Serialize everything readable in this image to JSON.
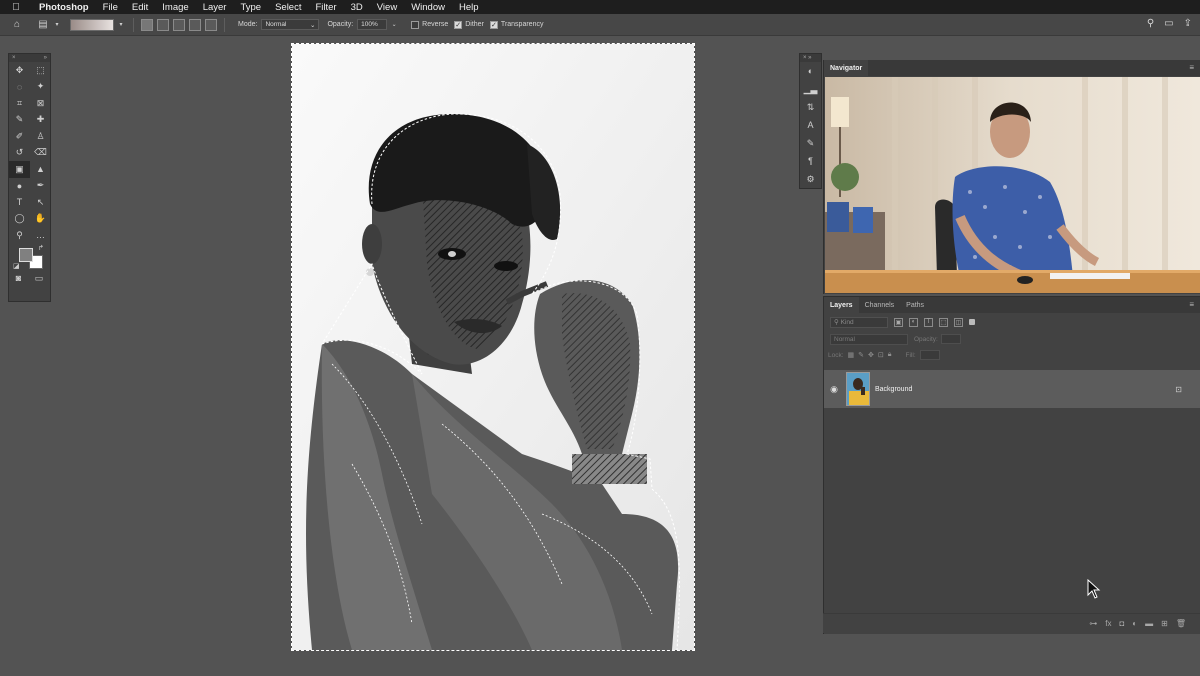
{
  "menubar": {
    "apple": "",
    "app_name": "Photoshop",
    "items": [
      "File",
      "Edit",
      "Image",
      "Layer",
      "Type",
      "Select",
      "Filter",
      "3D",
      "View",
      "Window",
      "Help"
    ]
  },
  "options_bar": {
    "mode_label": "Mode:",
    "mode_value": "Normal",
    "opacity_label": "Opacity:",
    "opacity_value": "100%",
    "reverse_label": "Reverse",
    "reverse_checked": false,
    "dither_label": "Dither",
    "dither_checked": true,
    "transparency_label": "Transparency",
    "transparency_checked": true
  },
  "tools": {
    "icons": [
      "move-icon",
      "marquee-icon",
      "lasso-icon",
      "magic-wand-icon",
      "crop-icon",
      "frame-icon",
      "eyedropper-icon",
      "healing-icon",
      "brush-icon",
      "stamp-icon",
      "history-brush-icon",
      "eraser-icon",
      "gradient-icon",
      "sharpen-icon",
      "dodge-icon",
      "pen-icon",
      "type-icon",
      "path-select-icon",
      "ellipse-icon",
      "hand-icon",
      "zoom-icon",
      "more-icon"
    ],
    "glyphs": [
      "✥",
      "⬚",
      "◌",
      "✦",
      "⌗",
      "⊠",
      "✎",
      "✚",
      "✐",
      "♙",
      "↺",
      "⌫",
      "▣",
      "▲",
      "●",
      "✒",
      "T",
      "↖",
      "◯",
      "✋",
      "⚲",
      "…"
    ],
    "selected_index": 12,
    "foreground_color": "#808080",
    "background_color": "#ffffff"
  },
  "navigator": {
    "tab": "Navigator"
  },
  "layers": {
    "tabs": [
      "Layers",
      "Channels",
      "Paths"
    ],
    "active_tab": "Layers",
    "kind_placeholder": "Kind",
    "blend_mode": "Normal",
    "opacity_label": "Opacity:",
    "lock_label": "Lock:",
    "fill_label": "Fill:",
    "layer_name": "Background"
  }
}
